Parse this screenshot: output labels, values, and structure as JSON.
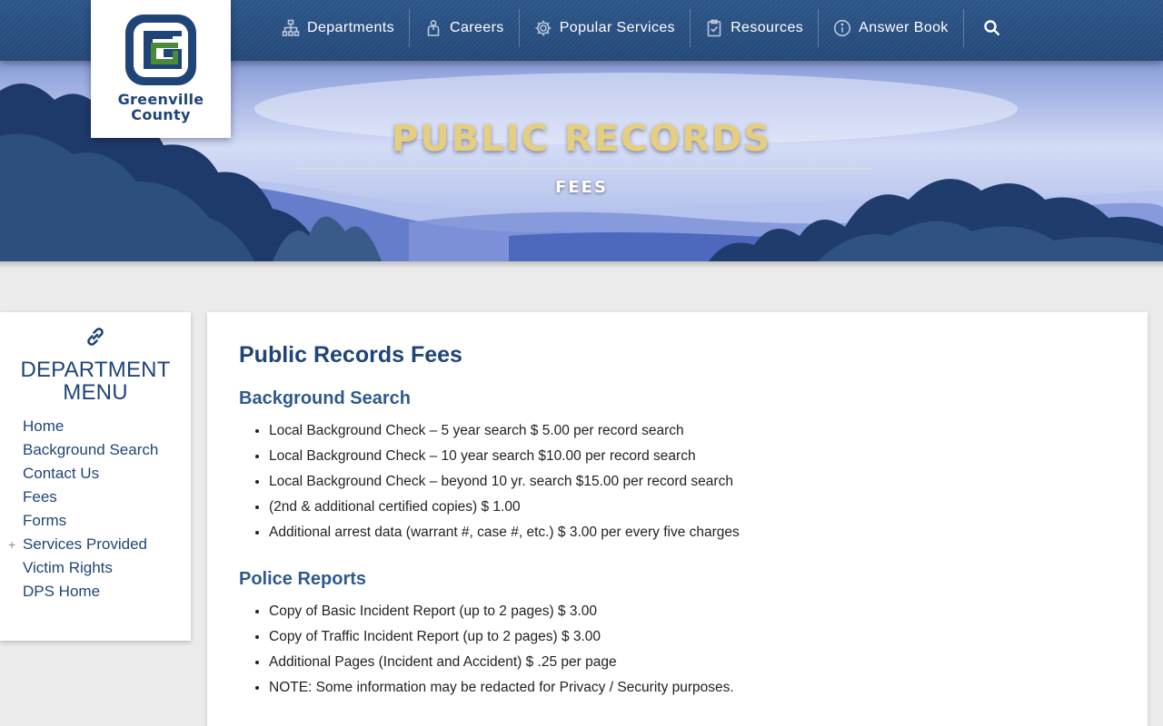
{
  "nav": {
    "items": [
      {
        "label": "Departments",
        "icon": "org-chart-icon"
      },
      {
        "label": "Careers",
        "icon": "briefcase-person-icon"
      },
      {
        "label": "Popular Services",
        "icon": "gear-icon"
      },
      {
        "label": "Resources",
        "icon": "clipboard-check-icon"
      },
      {
        "label": "Answer Book",
        "icon": "info-icon"
      }
    ],
    "search_icon": "search-icon"
  },
  "logo": {
    "line1": "Greenville",
    "line2": "County",
    "colors": {
      "blue": "#1f4478",
      "green": "#4a8b3a"
    }
  },
  "hero": {
    "title": "PUBLIC RECORDS",
    "subtitle": "FEES"
  },
  "sidebar": {
    "title_line1": "DEPARTMENT",
    "title_line2": "MENU",
    "icon": "link-icon",
    "items": [
      {
        "label": "Home"
      },
      {
        "label": "Background Search"
      },
      {
        "label": "Contact Us"
      },
      {
        "label": "Fees"
      },
      {
        "label": "Forms"
      },
      {
        "label": "Services Provided",
        "expand": "+"
      },
      {
        "label": "Victim Rights"
      },
      {
        "label": "DPS Home"
      }
    ]
  },
  "content": {
    "title": "Public Records Fees",
    "sections": [
      {
        "heading": "Background Search",
        "items": [
          "Local Background Check – 5 year search $ 5.00 per record search",
          "Local Background Check – 10 year search $10.00 per record search",
          "Local Background Check – beyond 10 yr. search $15.00 per record search",
          "(2nd & additional certified copies) $ 1.00",
          "Additional arrest data (warrant #, case #, etc.) $ 3.00 per every five charges"
        ]
      },
      {
        "heading": "Police Reports",
        "items": [
          "Copy of Basic Incident Report (up to 2 pages) $ 3.00",
          "Copy of Traffic Incident Report (up to 2 pages) $ 3.00",
          "Additional Pages (Incident and Accident) $ .25 per page",
          "NOTE: Some information may be redacted for Privacy / Security purposes."
        ]
      }
    ]
  },
  "colors": {
    "nav_bg": "#24497a",
    "title_gold": "#e5cf7e",
    "heading_blue": "#1f4478",
    "section_blue": "#2d5a8e",
    "page_bg": "#ebebeb"
  }
}
